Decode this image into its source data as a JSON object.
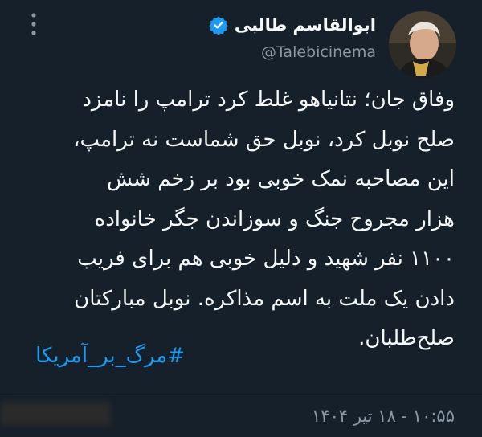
{
  "author": {
    "display_name": "ابوالقاسم طالبی",
    "handle": "@Talebicinema"
  },
  "tweet": {
    "lines": [
      "وفاق جان؛ نتانیاهو غلط کرد ترامپ را نامزد",
      "صلح نوبل کرد، نوبل حق شماست نه ترامپ،",
      "این مصاحبه نمک خوبی بود بر زخم شش",
      "هزار مجروح جنگ و سوزاندن جگر خانواده",
      "۱۱۰۰ نفر شهید و دلیل خوبی هم برای  فریب",
      "دادن یک ملت به اسم مذاکره. نوبل مبارکتان",
      "صلح‌طلبان."
    ],
    "hashtag": "#مرگ_بر_آمریکا",
    "timestamp": "۱۰:۵۵ - ۱۸ تیر ۱۴۰۴"
  },
  "icons": {
    "verified": "verified-badge-icon",
    "more": "more-options-icon"
  },
  "colors": {
    "background": "#15202b",
    "text": "#f7f9f9",
    "secondary_text": "#8b98a5",
    "accent": "#1d9bf0"
  }
}
